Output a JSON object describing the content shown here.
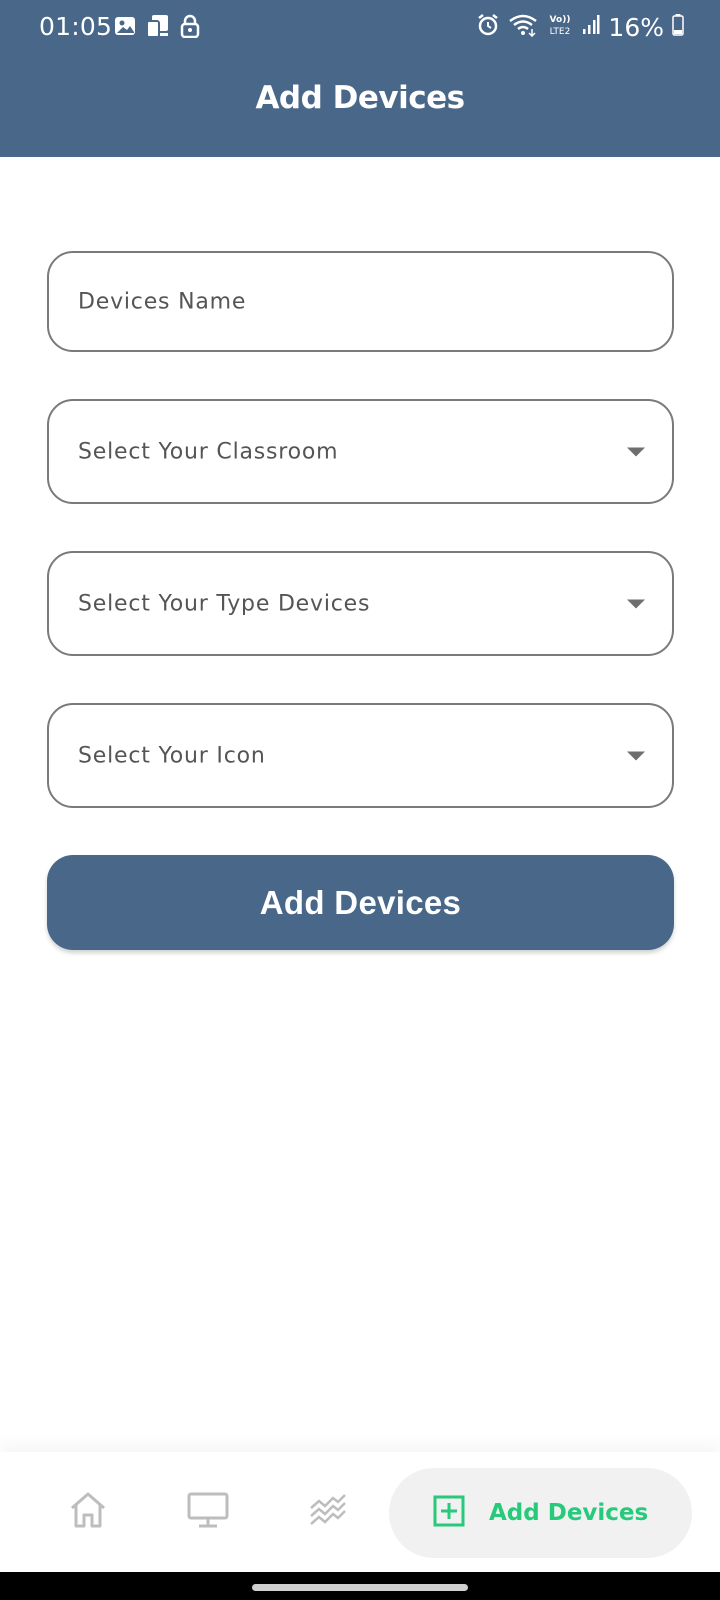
{
  "status_bar": {
    "time": "01:05",
    "battery": "16%",
    "icons": [
      "image-icon",
      "screen-mirror-icon",
      "lock-icon",
      "alarm-icon",
      "wifi-icon",
      "volte-lte2-icon",
      "signal-icon",
      "battery-icon"
    ],
    "network_label_top": "Vo))",
    "network_label_bottom": "LTE2"
  },
  "header": {
    "title": "Add Devices",
    "background": "#496789"
  },
  "form": {
    "device_name_placeholder": "Devices Name",
    "classroom_placeholder": "Select Your Classroom",
    "type_placeholder": "Select Your Type Devices",
    "icon_placeholder": "Select Your Icon",
    "submit_label": "Add Devices"
  },
  "bottom_nav": {
    "items": [
      {
        "icon": "home-icon"
      },
      {
        "icon": "monitor-icon"
      },
      {
        "icon": "chart-icon"
      }
    ],
    "active": {
      "icon": "add-box-icon",
      "label": "Add Devices",
      "color": "#27c97a"
    }
  }
}
